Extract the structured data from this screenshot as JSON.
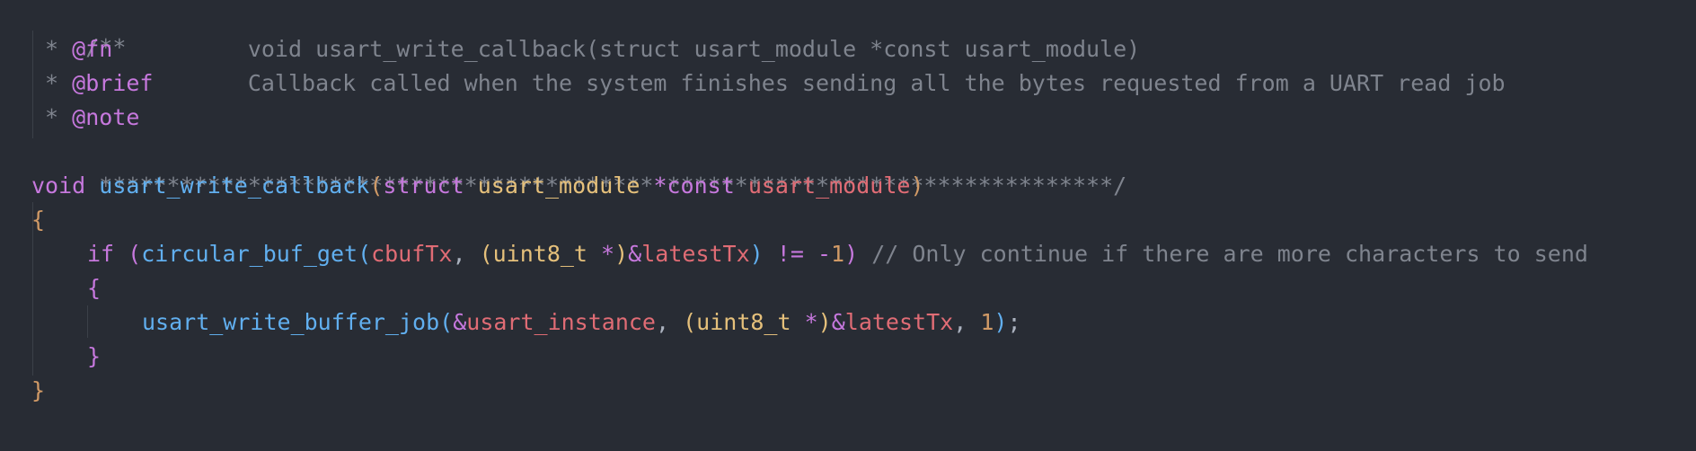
{
  "code": {
    "l1": "/**",
    "l2_star": " * ",
    "l2_tag": "@fn",
    "l2_pad": "          ",
    "l2_text": "void usart_write_callback(struct usart_module *const usart_module)",
    "l3_star": " * ",
    "l3_tag": "@brief",
    "l3_pad": "       ",
    "l3_text": "Callback called when the system finishes sending all the bytes requested from a UART read job",
    "l4_star": " * ",
    "l4_tag": "@note",
    "l5": " ***************************************************************************/",
    "l6": {
      "kw": "void",
      "fn": "usart_write_callback",
      "p1": "(",
      "kw2": "struct",
      "ty": "usart_module",
      "ptr": "*const",
      "var": "usart_module",
      "p2": ")"
    },
    "l7": "{",
    "l8": {
      "kw": "if",
      "p1": "(",
      "fn": "circular_buf_get",
      "p2": "(",
      "var1": "cbufTx",
      "comma": ",",
      "p3": "(",
      "ty": "uint8_t",
      "star": "*",
      "p4": ")",
      "amp": "&",
      "var2": "latestTx",
      "p5": ")",
      "neq": "!=",
      "neg": "-",
      "num": "1",
      "p6": ")",
      "comment": "// Only continue if there are more characters to send"
    },
    "l9": "{",
    "l10": {
      "fn": "usart_write_buffer_job",
      "p1": "(",
      "amp1": "&",
      "var1": "usart_instance",
      "comma1": ",",
      "p2": "(",
      "ty": "uint8_t",
      "star": "*",
      "p3": ")",
      "amp2": "&",
      "var2": "latestTx",
      "comma2": ",",
      "num": "1",
      "p4": ")",
      "semi": ";"
    },
    "l11": "}",
    "l12": "}"
  },
  "colors": {
    "background": "#282c34",
    "comment": "#7f848e",
    "keyword": "#c678dd",
    "function": "#61afef",
    "type": "#e5c07b",
    "variable": "#e06c75",
    "number": "#d19a66"
  }
}
